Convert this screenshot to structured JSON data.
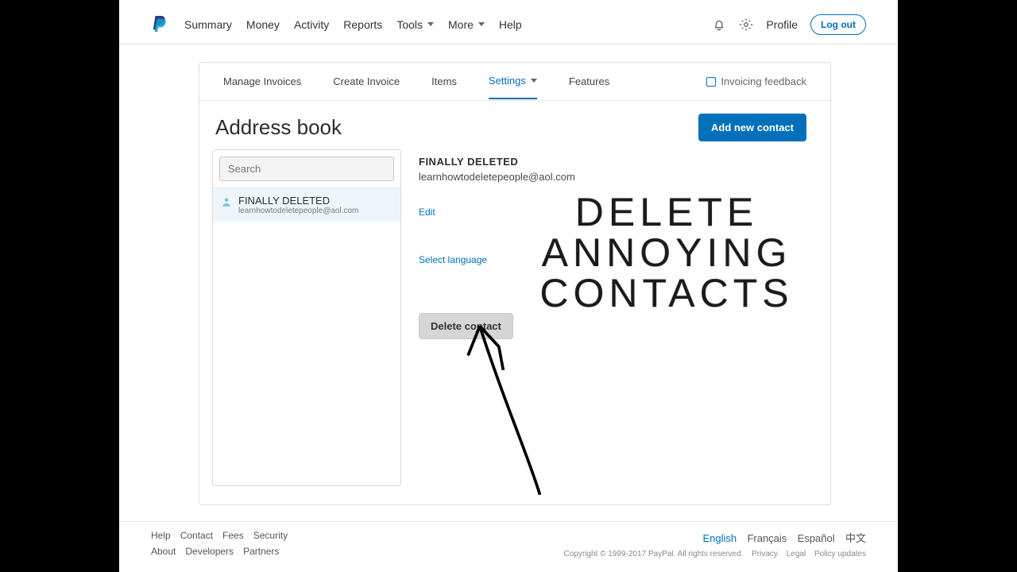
{
  "nav": {
    "summary": "Summary",
    "money": "Money",
    "activity": "Activity",
    "reports": "Reports",
    "tools": "Tools",
    "more": "More",
    "help": "Help"
  },
  "header": {
    "profile": "Profile",
    "logout": "Log out"
  },
  "tabs": {
    "manage": "Manage Invoices",
    "create": "Create Invoice",
    "items": "Items",
    "settings": "Settings",
    "features": "Features",
    "feedback": "Invoicing feedback"
  },
  "page": {
    "title": "Address book",
    "add_contact": "Add new contact",
    "search_placeholder": "Search"
  },
  "contacts": [
    {
      "name": "FINALLY DELETED",
      "email": "learnhowtodeletepeople@aol.com"
    }
  ],
  "detail": {
    "name": "FINALLY  DELETED",
    "email": "learnhowtodeletepeople@aol.com",
    "edit": "Edit",
    "select_language": "Select language",
    "delete": "Delete contact"
  },
  "overlay": {
    "text": "Delete Annoying Contacts"
  },
  "footer": {
    "row1": [
      "Help",
      "Contact",
      "Fees",
      "Security"
    ],
    "row2": [
      "About",
      "Developers",
      "Partners"
    ],
    "langs": [
      "English",
      "Français",
      "Español",
      "中文"
    ],
    "copyright": "Copyright © 1999-2017 PayPal. All rights reserved.",
    "legal": [
      "Privacy",
      "Legal",
      "Policy updates"
    ]
  }
}
